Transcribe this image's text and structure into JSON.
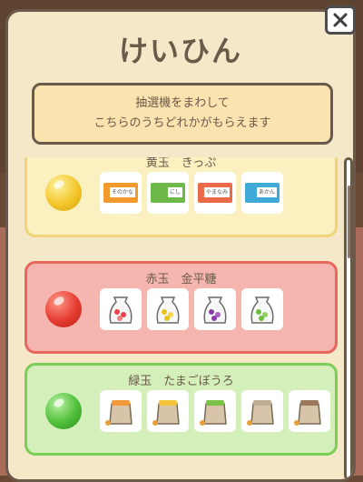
{
  "dialog": {
    "title": "けいひん",
    "description_line1": "抽選機をまわして",
    "description_line2": "こちらのうちどれかがもらえます",
    "close_icon": "close-icon"
  },
  "colors": {
    "yellow": "#f7e39a",
    "red": "#f2a3a0",
    "green": "#b7e29a"
  },
  "rewards": [
    {
      "name": "黄玉　きっぷ",
      "ball_color": "#f3c62a",
      "items": [
        "ticket-orange",
        "ticket-green",
        "ticket-red",
        "ticket-blue"
      ],
      "item_labels": [
        "そのかな",
        "にし",
        "やまなみ",
        "あかん"
      ]
    },
    {
      "name": "赤玉　金平糖",
      "ball_color": "#e53b2f",
      "items": [
        "candy-bag-red",
        "candy-bag-yellow",
        "candy-bag-purple",
        "candy-bag-green"
      ]
    },
    {
      "name": "緑玉　たまごぼうろ",
      "ball_color": "#4fbf3a",
      "items": [
        "cookie-bag-orange",
        "cookie-bag-yellow",
        "cookie-bag-green",
        "cookie-bag-plain",
        "cookie-bag-brown"
      ]
    }
  ]
}
